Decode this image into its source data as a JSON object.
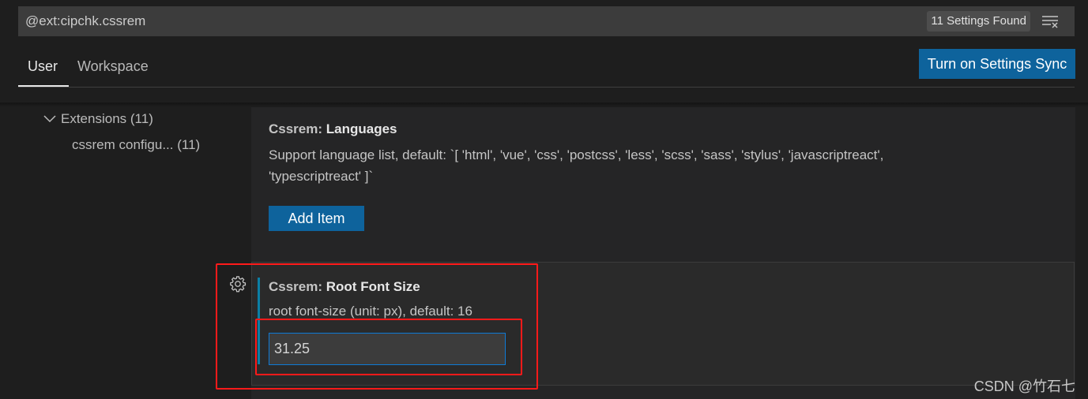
{
  "search": {
    "value": "@ext:cipchk.cssrem",
    "count": "11 Settings Found",
    "clear_icon": "clear-filter-icon"
  },
  "tabs": [
    {
      "label": "User",
      "active": true
    },
    {
      "label": "Workspace",
      "active": false
    }
  ],
  "sync_button": "Turn on Settings Sync",
  "tree": {
    "extensions": "Extensions (11)",
    "child": "cssrem configu... (11)"
  },
  "settings": [
    {
      "category": "Cssrem: ",
      "name": "Languages",
      "description_line1": "Support language list, default: `[ 'html', 'vue', 'css', 'postcss', 'less', 'scss', 'sass', 'stylus', 'javascriptreact',",
      "description_line2": "'typescriptreact' ]`",
      "button": "Add Item"
    },
    {
      "category": "Cssrem: ",
      "name": "Root Font Size",
      "description": "root font-size (unit: px), default: 16",
      "value": "31.25"
    }
  ],
  "watermark": "CSDN @竹石七",
  "colors": {
    "accent": "#0e639c",
    "annotation": "#ff1a1a"
  }
}
